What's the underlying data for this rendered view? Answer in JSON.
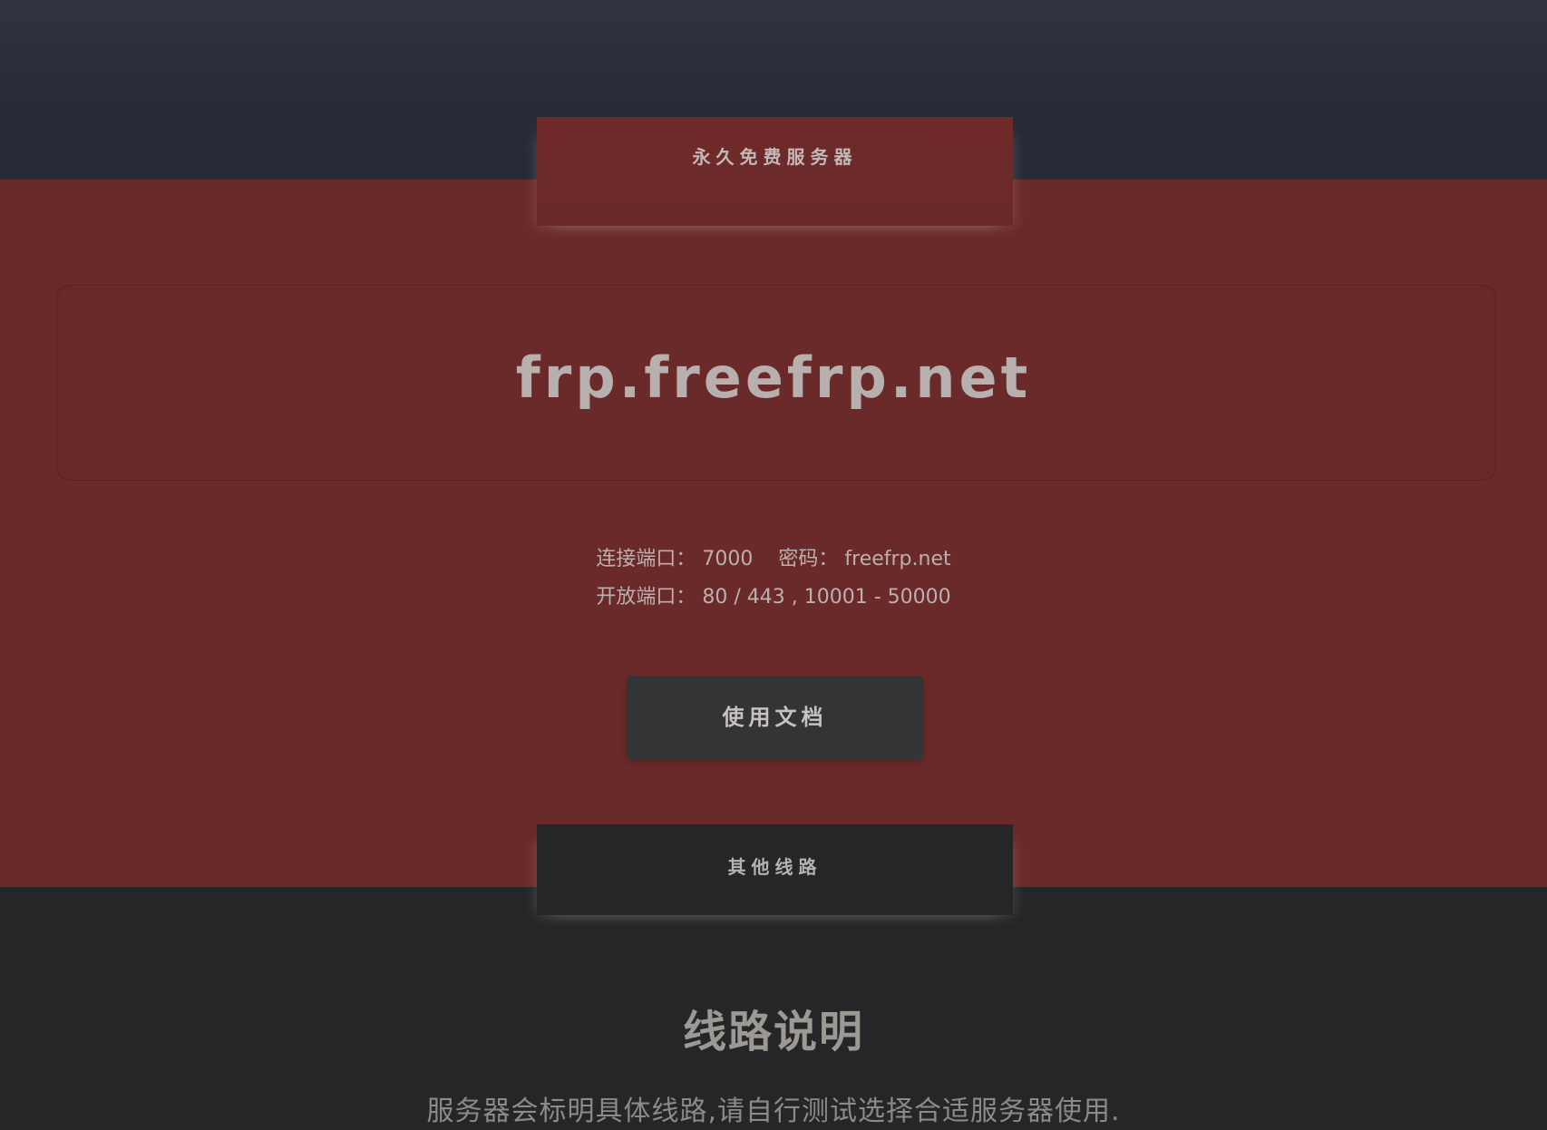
{
  "header": {
    "tab_label": "永久免费服务器"
  },
  "server": {
    "domain": "frp.freefrp.net",
    "connect_port_label": "连接端口：",
    "connect_port_value": "7000",
    "password_label": "密码：",
    "password_value": "freefrp.net",
    "open_ports_label": "开放端口：",
    "open_ports_value": "80 / 443 , 10001 - 50000"
  },
  "actions": {
    "docs_button_label": "使用文档"
  },
  "other_routes": {
    "tab_label": "其他线路",
    "title": "线路说明",
    "description": "服务器会标明具体线路,请自行测试选择合适服务器使用."
  },
  "colors": {
    "header_bg": "#2b2f3b",
    "red_bg": "#6a2a2a",
    "dark_bg": "#252628",
    "button_bg": "#333436"
  }
}
